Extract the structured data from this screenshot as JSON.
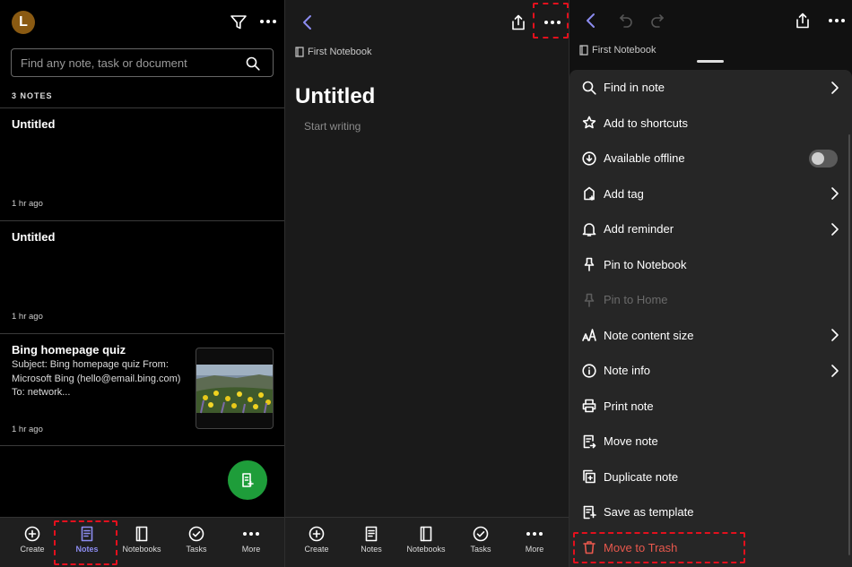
{
  "panel1": {
    "avatar_initial": "L",
    "search_placeholder": "Find any note, task or document",
    "notes_count": "3 NOTES",
    "notes": [
      {
        "title": "Untitled",
        "snippet": "",
        "time": "1 hr ago"
      },
      {
        "title": "Untitled",
        "snippet": "",
        "time": "1 hr ago"
      },
      {
        "title": "Bing homepage quiz",
        "snippet": "Subject: Bing homepage quiz From: Microsoft Bing (hello@email.bing.com) To: network...",
        "time": "1 hr ago"
      }
    ],
    "fab_color": "#1e9d3a"
  },
  "tabbar": [
    {
      "label": "Create",
      "icon": "plus-circle-icon"
    },
    {
      "label": "Notes",
      "icon": "note-icon"
    },
    {
      "label": "Notebooks",
      "icon": "notebook-icon"
    },
    {
      "label": "Tasks",
      "icon": "check-circle-icon"
    },
    {
      "label": "More",
      "icon": "more-dots-icon"
    }
  ],
  "active_tab_color": "#8c8cf0",
  "highlight_color": "#e3101d",
  "panel2": {
    "notebook": "First Notebook",
    "title": "Untitled",
    "placeholder": "Start writing"
  },
  "panel3": {
    "notebook": "First Notebook",
    "menu": [
      {
        "label": "Find in note",
        "icon": "search-icon",
        "chevron": true
      },
      {
        "label": "Add to shortcuts",
        "icon": "star-icon"
      },
      {
        "label": "Available offline",
        "icon": "download-icon",
        "toggle": false
      },
      {
        "label": "Add tag",
        "icon": "tag-icon",
        "chevron": true
      },
      {
        "label": "Add reminder",
        "icon": "bell-icon",
        "chevron": true
      },
      {
        "label": "Pin to Notebook",
        "icon": "pin-icon"
      },
      {
        "label": "Pin to Home",
        "icon": "pin-icon",
        "disabled": true
      },
      {
        "label": "Note content size",
        "icon": "text-size-icon",
        "chevron": true
      },
      {
        "label": "Note info",
        "icon": "info-icon",
        "chevron": true
      },
      {
        "label": "Print note",
        "icon": "printer-icon"
      },
      {
        "label": "Move note",
        "icon": "move-note-icon"
      },
      {
        "label": "Duplicate note",
        "icon": "duplicate-icon"
      },
      {
        "label": "Save as template",
        "icon": "template-icon"
      },
      {
        "label": "Move to Trash",
        "icon": "trash-icon",
        "danger": true
      }
    ],
    "danger_color": "#e8584d"
  }
}
